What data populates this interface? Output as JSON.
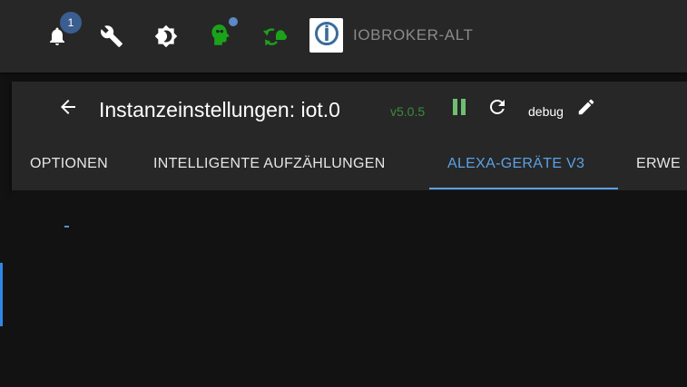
{
  "topbar": {
    "notification_count": "1",
    "host_name": "IOBROKER-ALT",
    "icons": [
      "bell-icon",
      "wrench-icon",
      "theme-brightness-icon",
      "expert-head-icon",
      "restart-cloud-icon",
      "iobroker-logo-icon"
    ]
  },
  "instance": {
    "title": "Instanzeinstellungen: iot.0",
    "version": "v5.0.5",
    "log_level": "debug"
  },
  "tabs": [
    {
      "label": "OPTIONEN",
      "active": false
    },
    {
      "label": "INTELLIGENTE AUFZÄHLUNGEN",
      "active": false
    },
    {
      "label": "ALEXA-GERÄTE V3",
      "active": true
    },
    {
      "label": "ERWE",
      "active": false
    }
  ],
  "colors": {
    "accent": "#5aa2e6",
    "topbar_bg": "#272727",
    "card_bg": "#272727",
    "page_bg": "#121212",
    "green": "#1aa31a",
    "version_green": "#3e8a3e",
    "pause_green": "#6fbf73"
  }
}
